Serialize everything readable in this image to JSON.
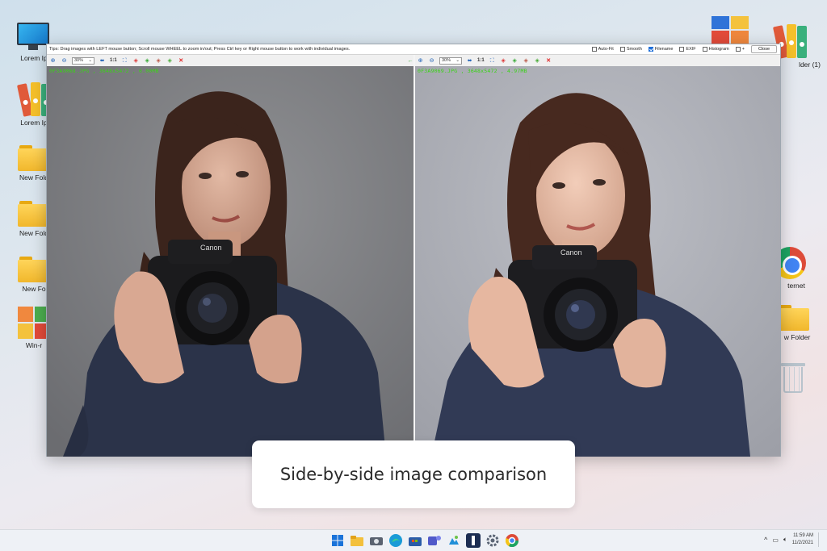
{
  "desktop": {
    "icons_left": [
      {
        "label": "Lorem Ip"
      },
      {
        "label": "Lorem Ip"
      },
      {
        "label": "New Fold"
      },
      {
        "label": "New Fold"
      },
      {
        "label": "New Fo"
      },
      {
        "label": "Win-r"
      }
    ],
    "icons_right": [
      {
        "label": ""
      },
      {
        "label": "lder (1)"
      },
      {
        "label": "ternet"
      },
      {
        "label": "w Folder"
      },
      {
        "label": ""
      }
    ]
  },
  "viewer": {
    "tip": "Tips: Drag images with LEFT mouse button; Scroll mouse WHEEL to zoom in/out; Press Ctrl key or Right mouse button to work with individual images.",
    "options": [
      {
        "label": "Auto-Fit",
        "checked": false
      },
      {
        "label": "Smooth",
        "checked": false
      },
      {
        "label": "Filename",
        "checked": true
      },
      {
        "label": "EXIF",
        "checked": false
      },
      {
        "label": "Histogram",
        "checked": false
      },
      {
        "label": "+",
        "checked": false
      }
    ],
    "close_label": "Close",
    "left": {
      "zoom": "30%",
      "one_to_one": "1:1",
      "file_info": "0F3A9068.JPG , 3648x5472 , 6.00MB"
    },
    "right": {
      "zoom": "30%",
      "one_to_one": "1:1",
      "file_info": "0F3A9069.JPG , 3648x5472 , 4.97MB"
    }
  },
  "caption": "Side-by-side image comparison",
  "taskbar": {
    "apps": [
      "windows-start",
      "file-explorer",
      "camera",
      "edge",
      "store",
      "teams",
      "photos",
      "compare-app",
      "settings",
      "chrome"
    ],
    "time": "11:59 AM",
    "date": "11/2/2021"
  }
}
